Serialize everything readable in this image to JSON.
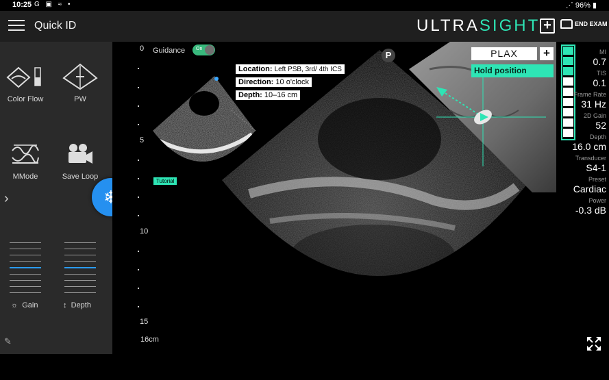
{
  "status_bar": {
    "time": "10:25",
    "left_icons": "G ▣ ≈ •",
    "battery": "96%"
  },
  "header": {
    "title": "Quick ID",
    "logo_main": "ULTRA",
    "logo_accent": "SIGHT",
    "end_exam": "END EXAM"
  },
  "tools": {
    "color_flow": "Color Flow",
    "pw": "PW",
    "mmode": "MMode",
    "save_loop": "Save Loop"
  },
  "sliders": {
    "gain": "Gain",
    "depth": "Depth"
  },
  "scale": {
    "ticks": [
      "0",
      "5",
      "10",
      "15"
    ],
    "depth_label": "16cm"
  },
  "guidance": {
    "label": "Guidance",
    "toggle_state": "On"
  },
  "tutorial_label": "Tutorial",
  "instructions": {
    "location_key": "Location:",
    "location_val": "Left PSB, 3rd/ 4th ICS",
    "direction_key": "Direction:",
    "direction_val": "10 o'clock",
    "depth_key": "Depth:",
    "depth_val": "10–16 cm"
  },
  "p_badge": "P",
  "view": {
    "name": "PLAX",
    "instruction": "Hold position"
  },
  "quality": {
    "filled": 3,
    "total": 9
  },
  "params": [
    {
      "label": "MI",
      "value": "0.7"
    },
    {
      "label": "TIS",
      "value": "0.1"
    },
    {
      "label": "Frame Rate",
      "value": "31 Hz"
    },
    {
      "label": "2D Gain",
      "value": "52"
    },
    {
      "label": "Depth",
      "value": "16.0 cm"
    },
    {
      "label": "Transducer",
      "value": "S4-1"
    },
    {
      "label": "Preset",
      "value": "Cardiac"
    },
    {
      "label": "Power",
      "value": "-0.3 dB"
    }
  ],
  "colors": {
    "accent": "#2ee5b5",
    "freeze": "#2590f0",
    "panel": "#2a2a2a"
  }
}
